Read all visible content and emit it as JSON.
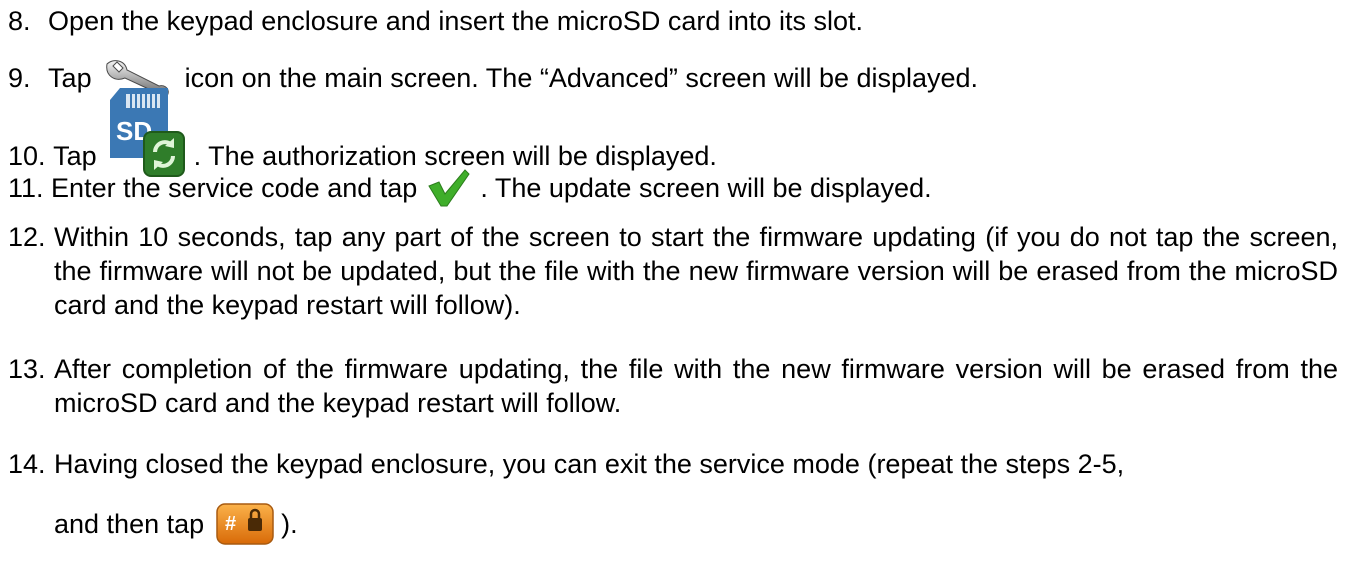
{
  "steps": [
    {
      "num": "8.",
      "text": "Open the keypad enclosure and insert the microSD card into its slot."
    },
    {
      "num": "9.",
      "pre": "Tap",
      "icon": "wrench-icon",
      "post": "icon on the main screen. The “Advanced” screen will be displayed."
    },
    {
      "num": "10.",
      "pre": "Tap",
      "icon": "sd-card-update-icon",
      "post": ". The authorization screen will be displayed."
    },
    {
      "num": "11.",
      "pre": "Enter the service code and tap",
      "icon": "checkmark-icon",
      "post": ". The update screen will be displayed."
    },
    {
      "num": "12.",
      "text": "Within 10 seconds, tap any part of the screen to start the firmware updating (if you do not tap the screen, the firmware will not be updated, but the file with the new firmware version will be erased from the microSD card and the keypad restart will follow)."
    },
    {
      "num": "13.",
      "text": "After completion of the firmware updating, the file with the new firmware version will be erased from the microSD card and the keypad restart will follow."
    },
    {
      "num": "14.",
      "text": "Having closed the keypad enclosure, you can exit the service mode (repeat the steps 2-5,",
      "text2_pre": "and then tap",
      "icon": "hash-lock-icon",
      "text2_post": ")."
    }
  ],
  "colors": {
    "checkmark": "#3fae2a",
    "sd_card": "#3b78b4",
    "update_bg": "#2f7d2a",
    "lock_button": "#e07a10"
  }
}
